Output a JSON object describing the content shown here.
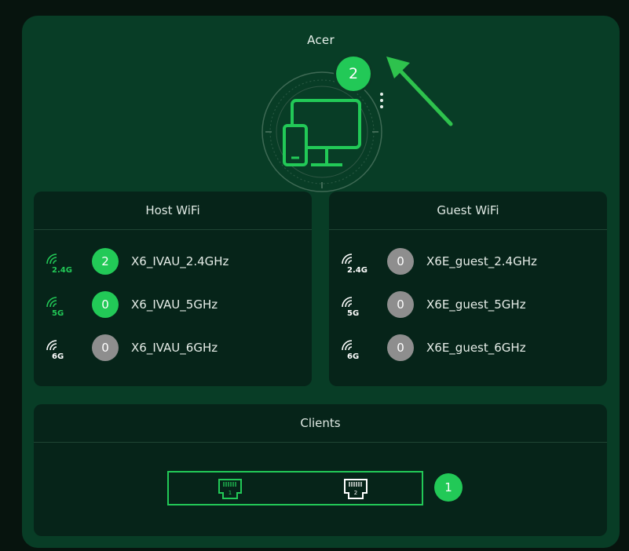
{
  "device": {
    "name": "Acer",
    "connected_count": "2",
    "icon": "device-desktop-phone-icon",
    "menu_icon": "kebab-menu-icon"
  },
  "colors": {
    "accent": "#22c957",
    "panel": "#083d26",
    "card": "#062419",
    "inactive": "#8e8e8e"
  },
  "host_wifi": {
    "title": "Host WiFi",
    "networks": [
      {
        "band": "2.4G",
        "count": "2",
        "ssid": "X6_IVAU_2.4GHz",
        "active": true
      },
      {
        "band": "5G",
        "count": "0",
        "ssid": "X6_IVAU_5GHz",
        "active": true
      },
      {
        "band": "6G",
        "count": "0",
        "ssid": "X6_IVAU_6GHz",
        "active": false
      }
    ]
  },
  "guest_wifi": {
    "title": "Guest WiFi",
    "networks": [
      {
        "band": "2.4G",
        "count": "0",
        "ssid": "X6E_guest_2.4GHz",
        "active": false
      },
      {
        "band": "5G",
        "count": "0",
        "ssid": "X6E_guest_5GHz",
        "active": false
      },
      {
        "band": "6G",
        "count": "0",
        "ssid": "X6E_guest_6GHz",
        "active": false
      }
    ]
  },
  "clients": {
    "title": "Clients",
    "ports": [
      {
        "label": "1",
        "active": true
      },
      {
        "label": "2",
        "active": false
      }
    ],
    "count": "1"
  }
}
